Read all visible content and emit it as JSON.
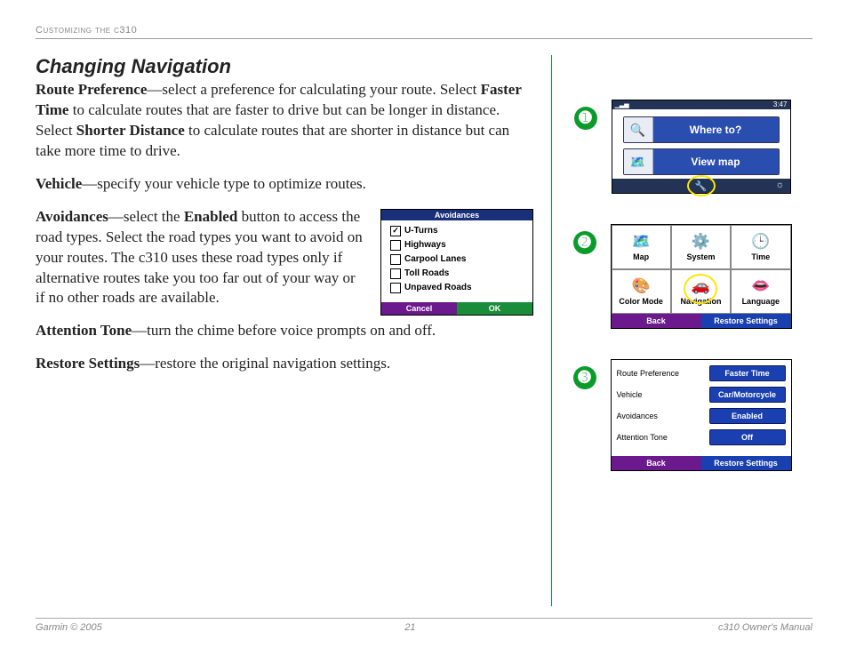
{
  "header": "Customizing the c310",
  "title": "Changing Navigation",
  "para_rp": {
    "term": "Route Preference",
    "t1": "—select a preference for calculating your route. Select ",
    "b1": "Faster Time",
    "t2": " to calculate routes that are faster to drive but can be longer in distance. Select ",
    "b2": "Shorter Distance",
    "t3": " to calculate routes that are shorter in distance but can take more time to drive."
  },
  "para_v": {
    "term": "Vehicle",
    "t1": "—specify your vehicle type to optimize routes."
  },
  "para_av": {
    "term": "Avoidances",
    "t1": "—select the ",
    "b1": "Enabled",
    "t2": " button to access the road types. Select the road types you want to avoid on your routes. The c310 uses these road types only if alternative routes take you too far out of your way or if no other roads are available."
  },
  "para_at": {
    "term": "Attention Tone",
    "t1": "—turn the chime before voice prompts on and off."
  },
  "para_rs": {
    "term": "Restore Settings",
    "t1": "—restore the original navigation settings."
  },
  "avoid_panel": {
    "title": "Avoidances",
    "items": [
      "U-Turns",
      "Highways",
      "Carpool Lanes",
      "Toll Roads",
      "Unpaved Roads"
    ],
    "checked_index": 0,
    "cancel": "Cancel",
    "ok": "OK"
  },
  "steps": {
    "s1": "➊",
    "s2": "➋",
    "s3": "➌"
  },
  "screen1": {
    "time": "3:47",
    "where": "Where to?",
    "view": "View map"
  },
  "screen2": {
    "cells": [
      "Map",
      "System",
      "Time",
      "Color Mode",
      "Navigation",
      "Language"
    ],
    "back": "Back",
    "restore": "Restore Settings"
  },
  "screen3": {
    "rows": [
      {
        "label": "Route Preference",
        "value": "Faster Time"
      },
      {
        "label": "Vehicle",
        "value": "Car/Motorcycle"
      },
      {
        "label": "Avoidances",
        "value": "Enabled"
      },
      {
        "label": "Attention Tone",
        "value": "Off"
      }
    ],
    "back": "Back",
    "restore": "Restore Settings"
  },
  "footer": {
    "left": "Garmin © 2005",
    "center": "21",
    "right": "c310 Owner's Manual"
  }
}
